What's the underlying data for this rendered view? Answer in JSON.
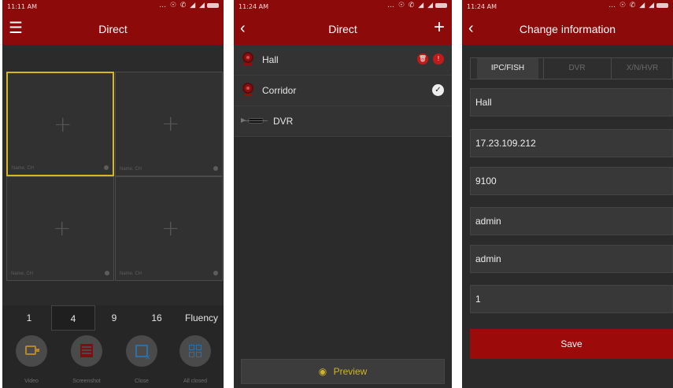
{
  "screen1": {
    "status_time": "11:11 AM",
    "status_icons": "… ☉ ✆ ◢ ◢",
    "title": "Direct",
    "menu_icon": "hamburger-menu-icon",
    "cells": [
      {
        "caption": "Name, CH",
        "selected": true
      },
      {
        "caption": "Name, CH",
        "selected": false
      },
      {
        "caption": "Name, CH",
        "selected": false
      },
      {
        "caption": "Name, CH",
        "selected": false
      }
    ],
    "split_options": [
      "1",
      "4",
      "9",
      "16",
      "Fluency"
    ],
    "split_selected": "4",
    "actions": [
      {
        "label": "Video",
        "icon": "video-record-icon"
      },
      {
        "label": "Screenshot",
        "icon": "screenshot-icon"
      },
      {
        "label": "Close",
        "icon": "close-window-icon"
      },
      {
        "label": "All closed",
        "icon": "close-all-icon"
      }
    ]
  },
  "screen2": {
    "status_time": "11:24 AM",
    "status_icons": "… ☉ ✆ ◢ ◢",
    "title": "Direct",
    "back_icon": "‹",
    "add_icon": "+",
    "devices": [
      {
        "name": "Hall",
        "type": "camera"
      },
      {
        "name": "Corridor",
        "type": "camera"
      },
      {
        "name": "DVR",
        "type": "dvr"
      }
    ],
    "preview_label": "Preview",
    "preview_icon": "◉"
  },
  "screen3": {
    "status_time": "11:24 AM",
    "status_icons": "… ☉ ✆ ◢ ◢",
    "title": "Change information",
    "back_icon": "‹",
    "tabs": [
      "IPC/FISH",
      "DVR",
      "X/N/HVR"
    ],
    "active_tab": "IPC/FISH",
    "fields": {
      "name": "Hall",
      "address": "17.23.109.212",
      "port": "9100",
      "username": "admin",
      "password": "admin",
      "channel": "1"
    },
    "save_label": "Save"
  },
  "colors": {
    "brand_red": "#8c0a0a",
    "selected_border": "#d6b81c",
    "preview_accent": "#d1b42a"
  }
}
